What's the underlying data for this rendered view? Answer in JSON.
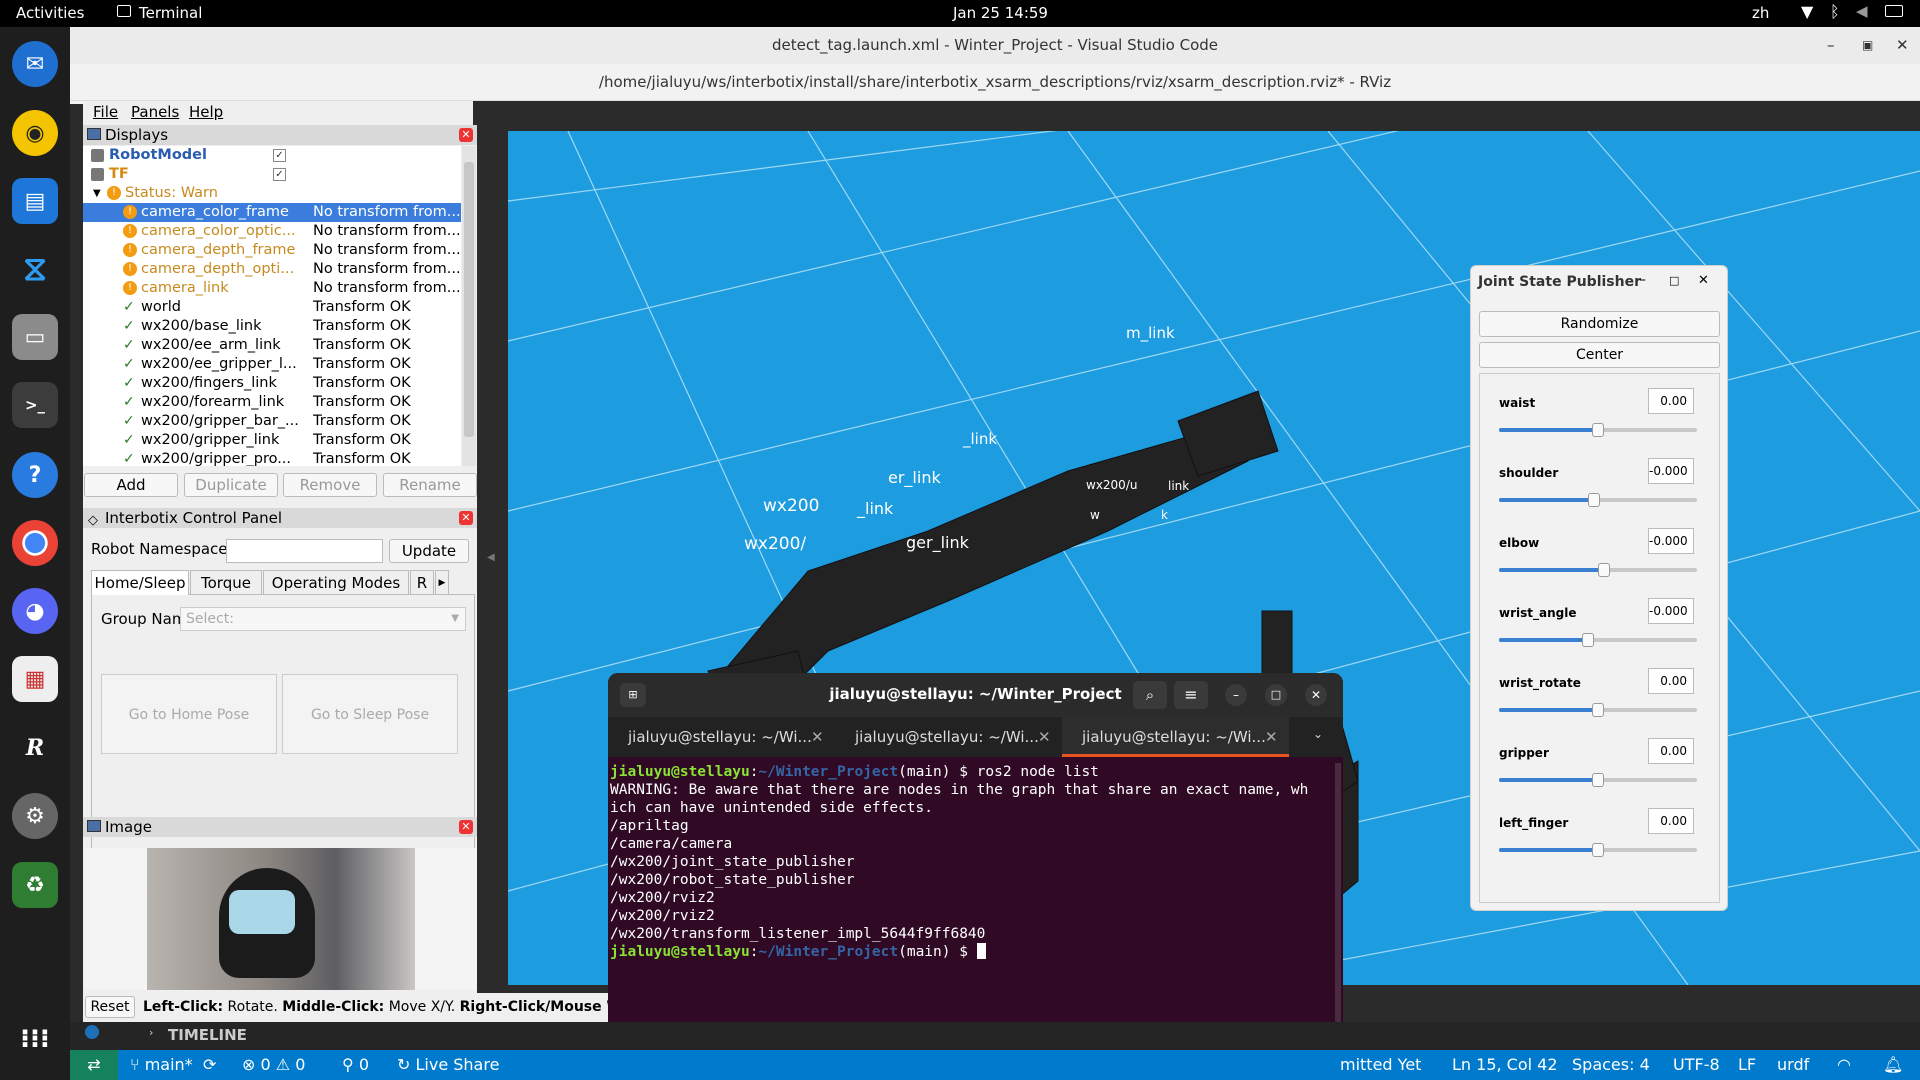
{
  "topbar": {
    "activities": "Activities",
    "app": "Terminal",
    "datetime": "Jan 25  14:59",
    "lang": "zh"
  },
  "dock": {
    "items": [
      "thunderbird-icon",
      "rhythmbox-icon",
      "writer-icon",
      "vscode-icon",
      "files-icon",
      "terminal-icon",
      "help-icon",
      "chrome-icon",
      "discord-icon",
      "viewer-icon",
      "rviz-icon",
      "settings-icon",
      "trash-icon",
      "apps-grid-icon"
    ]
  },
  "vscode": {
    "title": "detect_tag.launch.xml - Winter_Project - Visual Studio Code",
    "edge_letter": "F"
  },
  "rviz": {
    "title": "/home/jialuyu/ws/interbotix/install/share/interbotix_xsarm_descriptions/rviz/xsarm_description.rviz* - RViz",
    "menu": [
      "File",
      "Panels",
      "Help"
    ],
    "displays": {
      "header": "Displays",
      "rows": [
        {
          "label": "RobotModel",
          "value": "",
          "kind": "display"
        },
        {
          "label": "TF",
          "value": "",
          "kind": "display"
        },
        {
          "label": "Status: Warn",
          "value": "",
          "kind": "status"
        },
        {
          "label": "camera_color_frame",
          "value": "No transform from...",
          "kind": "warn"
        },
        {
          "label": "camera_color_optic...",
          "value": "No transform from...",
          "kind": "warn"
        },
        {
          "label": "camera_depth_frame",
          "value": "No transform from...",
          "kind": "warn"
        },
        {
          "label": "camera_depth_opti...",
          "value": "No transform from...",
          "kind": "warn"
        },
        {
          "label": "camera_link",
          "value": "No transform from...",
          "kind": "warn"
        },
        {
          "label": "world",
          "value": "Transform OK",
          "kind": "ok"
        },
        {
          "label": "wx200/base_link",
          "value": "Transform OK",
          "kind": "ok"
        },
        {
          "label": "wx200/ee_arm_link",
          "value": "Transform OK",
          "kind": "ok"
        },
        {
          "label": "wx200/ee_gripper_l...",
          "value": "Transform OK",
          "kind": "ok"
        },
        {
          "label": "wx200/fingers_link",
          "value": "Transform OK",
          "kind": "ok"
        },
        {
          "label": "wx200/forearm_link",
          "value": "Transform OK",
          "kind": "ok"
        },
        {
          "label": "wx200/gripper_bar_...",
          "value": "Transform OK",
          "kind": "ok"
        },
        {
          "label": "wx200/gripper_link",
          "value": "Transform OK",
          "kind": "ok"
        },
        {
          "label": "wx200/gripper_pro...",
          "value": "Transform OK",
          "kind": "ok"
        }
      ],
      "buttons": [
        "Add",
        "Duplicate",
        "Remove",
        "Rename"
      ]
    },
    "control_panel": {
      "header": "Interbotix Control Panel",
      "namespace_label": "Robot Namespace:",
      "update": "Update",
      "tabs": [
        "Home/Sleep",
        "Torque",
        "Operating Modes",
        "R"
      ],
      "group_label": "Group Name:",
      "group_placeholder": "Select:",
      "home": "Go to Home Pose",
      "sleep": "Go to Sleep Pose"
    },
    "image_panel": {
      "header": "Image"
    },
    "status": {
      "reset": "Reset",
      "hint_b1": "Left-Click:",
      "hint_t1": " Rotate. ",
      "hint_b2": "Middle-Click:",
      "hint_t2": " Move X/Y. ",
      "hint_b3": "Right-Click/Mouse Whe",
      "hint_t3": ""
    }
  },
  "view3d": {
    "labels": [
      "m_link",
      "_link",
      "er_link",
      "wx200/u",
      "_link",
      "wx200",
      "wx200/",
      "ger_link",
      "link",
      "k",
      "w"
    ]
  },
  "jsp": {
    "title": "Joint State Publisher",
    "randomize": "Randomize",
    "center": "Center",
    "joints": [
      {
        "name": "waist",
        "value": "0.00",
        "level": 0.5
      },
      {
        "name": "shoulder",
        "value": "-0.000",
        "level": 0.48
      },
      {
        "name": "elbow",
        "value": "-0.000",
        "level": 0.53
      },
      {
        "name": "wrist_angle",
        "value": "-0.000",
        "level": 0.45
      },
      {
        "name": "wrist_rotate",
        "value": "0.00",
        "level": 0.5
      },
      {
        "name": "gripper",
        "value": "0.00",
        "level": 0.5
      },
      {
        "name": "left_finger",
        "value": "0.00",
        "level": 0.5
      }
    ]
  },
  "terminal": {
    "title": "jialuyu@stellayu: ~/Winter_Project",
    "tabs": [
      "jialuyu@stellayu: ~/Wi...",
      "jialuyu@stellayu: ~/Wi...",
      "jialuyu@stellayu: ~/Wi..."
    ],
    "prompt_user": "jialuyu@stellayu",
    "prompt_path": "~/Winter_Project",
    "branch": "(main) $ ",
    "command": "ros2 node list",
    "output": [
      "WARNING: Be aware that there are nodes in the graph that share an exact name, wh",
      "ich can have unintended side effects.",
      "/apriltag",
      "/camera/camera",
      "/wx200/joint_state_publisher",
      "/wx200/robot_state_publisher",
      "/wx200/rviz2",
      "/wx200/rviz2",
      "/wx200/transform_listener_impl_5644f9ff6840"
    ]
  },
  "timeline": {
    "label": "TIMELINE"
  },
  "statusbar": {
    "branch": "main*",
    "errors": "0",
    "warnings": "0",
    "ports": "0",
    "liveshare": "Live Share",
    "commit": "mitted Yet",
    "position": "Ln 15, Col 42",
    "spaces": "Spaces: 4",
    "encoding": "UTF-8",
    "eol": "LF",
    "lang": "urdf"
  }
}
